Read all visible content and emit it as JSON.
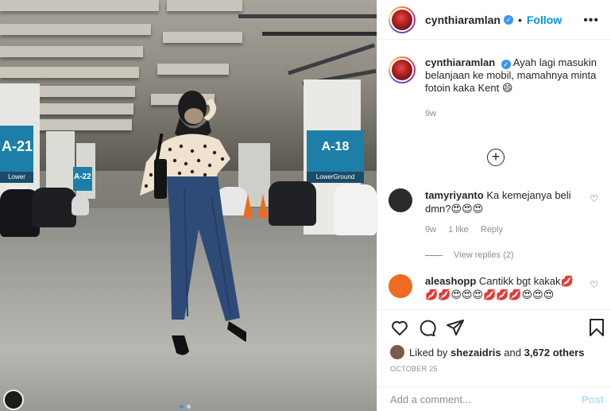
{
  "post": {
    "username": "cynthiaramlan",
    "verified_mark": "✓",
    "separator": "•",
    "follow_label": "Follow",
    "more_label": "•••",
    "caption_text": "Ayah lagi masukin belanjaan ke mobil, mamahnya minta fotoin kaka Kent 😄",
    "caption_time": "9w",
    "load_more_label": "+"
  },
  "photo": {
    "sign_left_text": "A-21",
    "sign_left_sub": "Lower Ground",
    "sign_mid_text": "A-22",
    "sign_right_text": "A-18",
    "sign_right_sub": "LowerGround"
  },
  "comments": [
    {
      "username": "tamyriyanto",
      "text": "Ka kemejanya beli dmn?😍😍😍",
      "time": "9w",
      "likes": "1 like",
      "reply_label": "Reply",
      "view_replies": "View replies (2)"
    },
    {
      "username": "aleashopp",
      "text": "Cantikk bgt kakak💋💋💋😍😍😍💋💋💋😍😍😍"
    }
  ],
  "likes": {
    "prefix": "Liked by",
    "user": "shezaidris",
    "connector": "and",
    "others": "3,672 others"
  },
  "date": "OCTOBER 25",
  "add_comment": {
    "placeholder": "Add a comment...",
    "post_label": "Post"
  },
  "colors": {
    "accent": "#0095f6",
    "verified": "#3897f0",
    "muted": "#8e8e8e",
    "sign_blue": "#1d7fa8",
    "cone_orange": "#ef6a1c"
  },
  "icons": [
    "heart-icon",
    "comment-icon",
    "share-icon",
    "bookmark-icon",
    "verified-icon",
    "more-options-icon",
    "plus-circle-icon"
  ]
}
